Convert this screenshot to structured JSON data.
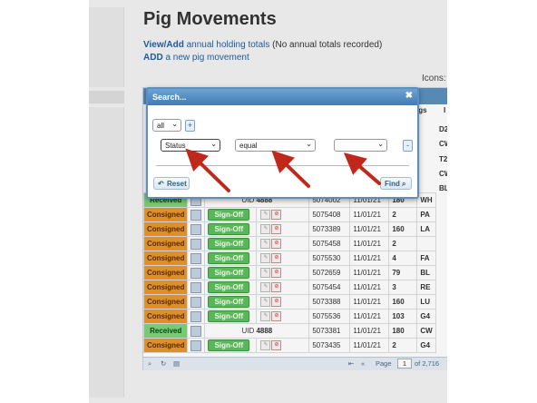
{
  "page": {
    "title": "Pig Movements",
    "line1_link": "View/Add",
    "line1_rest": "annual holding totals",
    "line1_note": "(No annual totals recorded)",
    "line2_link": "ADD",
    "line2_rest": "a new pig movement",
    "icons_label": "Icons:"
  },
  "table": {
    "header_fragments": [
      "igs",
      "I"
    ],
    "rows": [
      {
        "status": "Received",
        "kind": "uid",
        "uid_label": "UID",
        "uid": "4888",
        "id": "5074002",
        "date": "11/01/21",
        "pigs": "180",
        "dest": "WH"
      },
      {
        "status": "Consigned",
        "kind": "sign",
        "sign": "Sign-Off",
        "id": "5075408",
        "date": "11/01/21",
        "pigs": "2",
        "dest": "PA"
      },
      {
        "status": "Consigned",
        "kind": "sign",
        "sign": "Sign-Off",
        "id": "5073389",
        "date": "11/01/21",
        "pigs": "160",
        "dest": "LA"
      },
      {
        "status": "Consigned",
        "kind": "sign",
        "sign": "Sign-Off",
        "id": "5075458",
        "date": "11/01/21",
        "pigs": "2",
        "dest": ""
      },
      {
        "status": "Consigned",
        "kind": "sign",
        "sign": "Sign-Off",
        "id": "5075530",
        "date": "11/01/21",
        "pigs": "4",
        "dest": "FA"
      },
      {
        "status": "Consigned",
        "kind": "sign",
        "sign": "Sign-Off",
        "id": "5072659",
        "date": "11/01/21",
        "pigs": "79",
        "dest": "BL"
      },
      {
        "status": "Consigned",
        "kind": "sign",
        "sign": "Sign-Off",
        "id": "5075454",
        "date": "11/01/21",
        "pigs": "3",
        "dest": "RE"
      },
      {
        "status": "Consigned",
        "kind": "sign",
        "sign": "Sign-Off",
        "id": "5073388",
        "date": "11/01/21",
        "pigs": "160",
        "dest": "LU"
      },
      {
        "status": "Consigned",
        "kind": "sign",
        "sign": "Sign-Off",
        "id": "5075536",
        "date": "11/01/21",
        "pigs": "103",
        "dest": "G4"
      },
      {
        "status": "Received",
        "kind": "uid",
        "uid_label": "UID",
        "uid": "4888",
        "id": "5073381",
        "date": "11/01/21",
        "pigs": "180",
        "dest": "CW"
      },
      {
        "status": "Consigned",
        "kind": "sign",
        "sign": "Sign-Off",
        "id": "5073435",
        "date": "11/01/21",
        "pigs": "2",
        "dest": "G4"
      }
    ],
    "hidden_right_col": [
      "D2",
      "CW",
      "T2",
      "CW",
      "BL"
    ]
  },
  "pager": {
    "page_label": "Page",
    "page_value": "1",
    "of_label": "of 2,716"
  },
  "dialog": {
    "title": "Search...",
    "close": "✖",
    "group_op": "all",
    "add_group": "+",
    "field": "Status",
    "operator": "equal",
    "value": "",
    "remove": "-",
    "reset": "Reset",
    "find": "Find"
  },
  "colors": {
    "consigned": "#e8962a",
    "received": "#7bd27b",
    "sign_off": "#5cc05c",
    "header_blue": "#5b8fbd",
    "arrow_red": "#c0281c"
  }
}
